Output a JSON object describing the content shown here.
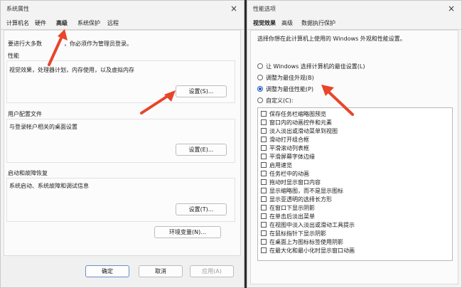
{
  "left_window": {
    "title": "系统属性",
    "close_glyph": "×",
    "tabs": [
      {
        "label": "计算机名",
        "active": false
      },
      {
        "label": "硬件",
        "active": false
      },
      {
        "label": "高级",
        "active": true
      },
      {
        "label": "系统保护",
        "active": false
      },
      {
        "label": "远程",
        "active": false
      }
    ],
    "admin_note": "要进行大多数更改，你必须作为管理员登录。",
    "admin_note_visible_start": "要进行大多数",
    "admin_note_visible_end": "，你必须作为管理员登录。",
    "performance": {
      "heading": "性能",
      "description": "视觉效果，处理器计划，内存使用，以及虚拟内存",
      "button": "设置(S)..."
    },
    "user_profiles": {
      "heading": "用户配置文件",
      "description": "与登录帐户相关的桌面设置",
      "button": "设置(E)..."
    },
    "startup_recovery": {
      "heading": "启动和故障恢复",
      "description": "系统启动、系统故障和调试信息",
      "button": "设置(T)..."
    },
    "env_button": "环境变量(N)...",
    "footer": {
      "ok": "确定",
      "cancel": "取消",
      "apply": "应用(A)"
    }
  },
  "right_window": {
    "title": "性能选项",
    "close_glyph": "×",
    "tabs": [
      {
        "label": "视觉效果",
        "active": true
      },
      {
        "label": "高级",
        "active": false
      },
      {
        "label": "数据执行保护",
        "active": false
      }
    ],
    "intro": "选择你想在此计算机上使用的 Windows 外观和性能设置。",
    "radios": [
      {
        "label": "让 Windows 选择计算机的最佳设置(L)",
        "checked": false
      },
      {
        "label": "调整为最佳外观(B)",
        "checked": false
      },
      {
        "label": "调整为最佳性能(P)",
        "checked": true
      },
      {
        "label": "自定义(C):",
        "checked": false
      }
    ],
    "effects": [
      "保存任务栏缩略图预览",
      "窗口内的动画控件和元素",
      "淡入淡出或滑动菜单到视图",
      "滑动打开组合框",
      "平滑滚动列表框",
      "平滑屏幕字体边缘",
      "启用速览",
      "任务栏中的动画",
      "拖动时显示窗口内容",
      "显示缩略图，而不是显示图标",
      "显示亚透明的选择长方形",
      "在窗口下显示阴影",
      "在单击后淡出菜单",
      "在视图中淡入淡出或滑动工具提示",
      "在鼠标指针下显示阴影",
      "在桌面上为图标标签使用阴影",
      "在最大化和最小化时显示窗口动画"
    ]
  },
  "annotation_color": "#e8452a"
}
